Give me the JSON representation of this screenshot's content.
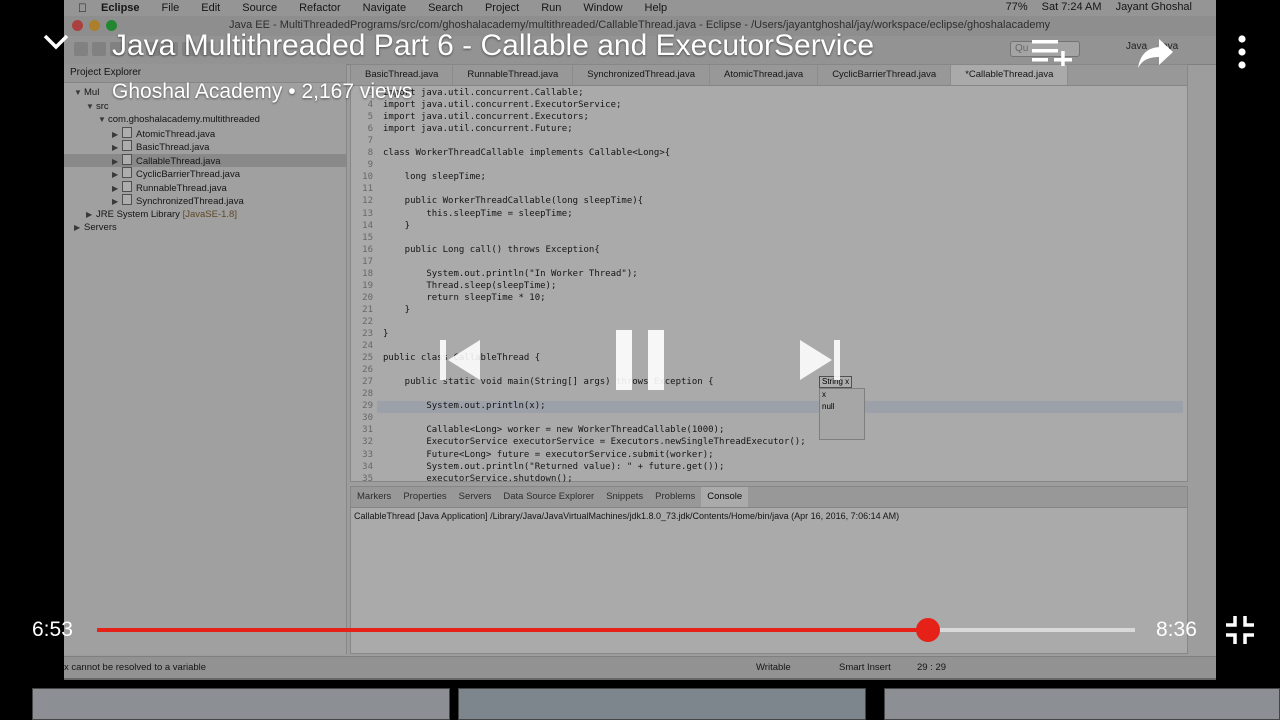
{
  "video": {
    "title": "Java Multithreaded Part 6 - Callable and ExecutorService",
    "channel_views": "Ghoshal Academy • 2,167 views",
    "current_time": "6:53",
    "total_time": "8:36",
    "progress": 0.801,
    "accent_color": "#e62117"
  },
  "mac_menu": {
    "app": "Eclipse",
    "items": [
      "File",
      "Edit",
      "Source",
      "Refactor",
      "Navigate",
      "Search",
      "Project",
      "Run",
      "Window",
      "Help"
    ],
    "battery": "77%",
    "clock": "Sat 7:24 AM",
    "user": "Jayant Ghoshal"
  },
  "window_title": "Java EE - MultiThreadedPrograms/src/com/ghoshalacademy/multithreaded/CallableThread.java - Eclipse - /Users/jayantghoshal/jay/workspace/eclipse/ghoshalacademy",
  "toolbar": {
    "quick_access": "Qu",
    "perspectives": [
      "Java",
      "Java"
    ]
  },
  "project_explorer": {
    "header": "Project Explorer",
    "project": "Mul",
    "src": "src",
    "package": "com.ghoshalacademy.multithreaded",
    "files": [
      "AtomicThread.java",
      "BasicThread.java",
      "CallableThread.java",
      "CyclicBarrierThread.java",
      "RunnableThread.java",
      "SynchronizedThread.java"
    ],
    "jre": "JRE System Library",
    "jre_ver": "[JavaSE-1.8]",
    "servers": "Servers"
  },
  "editor": {
    "tabs": [
      "BasicThread.java",
      "RunnableThread.java",
      "SynchronizedThread.java",
      "AtomicThread.java",
      "CyclicBarrierThread.java",
      "*CallableThread.java"
    ],
    "line_numbers": [
      "3",
      "4",
      "5",
      "6",
      "7",
      "8",
      "9",
      "10",
      "11",
      "12",
      "13",
      "14",
      "15",
      "16",
      "17",
      "18",
      "19",
      "20",
      "21",
      "22",
      "23",
      "24",
      "25",
      "26",
      "27",
      "28",
      "29",
      "30",
      "31",
      "32",
      "33",
      "34",
      "35"
    ],
    "lines": [
      "import java.util.concurrent.Callable;",
      "import java.util.concurrent.ExecutorService;",
      "import java.util.concurrent.Executors;",
      "import java.util.concurrent.Future;",
      "",
      "class WorkerThreadCallable implements Callable<Long>{",
      "",
      "    long sleepTime;",
      "",
      "    public WorkerThreadCallable(long sleepTime){",
      "        this.sleepTime = sleepTime;",
      "    }",
      "",
      "    public Long call() throws Exception{",
      "",
      "        System.out.println(\"In Worker Thread\");",
      "        Thread.sleep(sleepTime);",
      "        return sleepTime * 10;",
      "    }",
      "",
      "}",
      "",
      "public class CallableThread {",
      "",
      "    public static void main(String[] args) throws Exception {",
      "",
      "        System.out.println(x);",
      "",
      "        Callable<Long> worker = new WorkerThreadCallable(1000);",
      "        ExecutorService executorService = Executors.newSingleThreadExecutor();",
      "        Future<Long> future = executorService.submit(worker);",
      "        System.out.println(\"Returned value): \" + future.get());",
      "        executorService.shutdown();"
    ],
    "hint": "String x",
    "popup_items": [
      "x",
      "null"
    ]
  },
  "console": {
    "tabs": [
      "Markers",
      "Properties",
      "Servers",
      "Data Source Explorer",
      "Snippets",
      "Problems",
      "Console"
    ],
    "line": "CallableThread [Java Application] /Library/Java/JavaVirtualMachines/jdk1.8.0_73.jdk/Contents/Home/bin/java (Apr 16, 2016, 7:06:14 AM)"
  },
  "status_bar": {
    "message": "x cannot be resolved to a variable",
    "mode": "Writable",
    "insert": "Smart Insert",
    "position": "29 : 29"
  }
}
